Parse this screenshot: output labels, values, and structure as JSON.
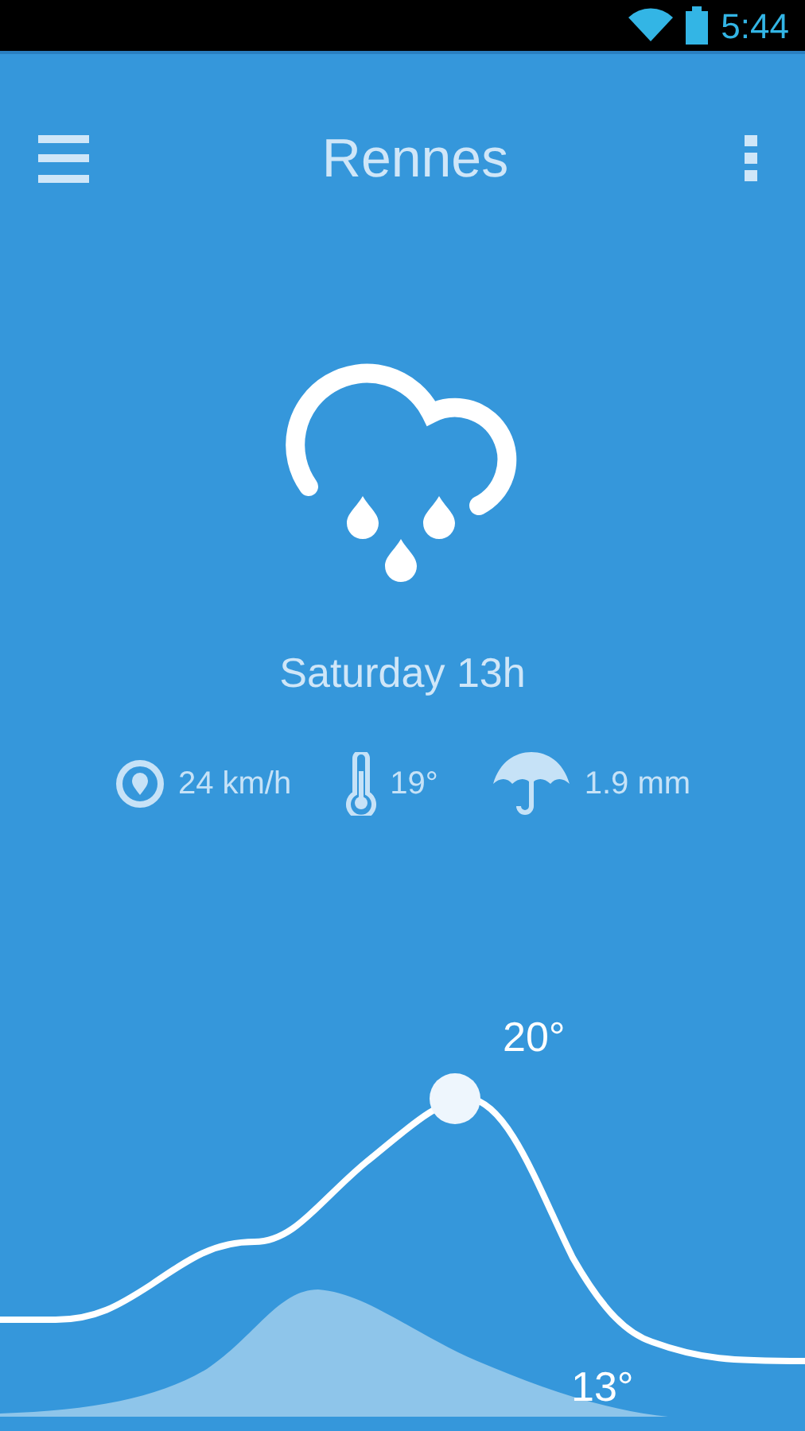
{
  "status_bar": {
    "time": "5:44"
  },
  "header": {
    "title": "Rennes"
  },
  "forecast": {
    "time": "Saturday 13h"
  },
  "stats": [
    {
      "kind": "wind",
      "value": "24 km/h"
    },
    {
      "kind": "temperature",
      "value": "19°"
    },
    {
      "kind": "rain",
      "value": "1.9 mm"
    }
  ],
  "curve": {
    "high_label": "20°",
    "low_label": "13°"
  }
}
